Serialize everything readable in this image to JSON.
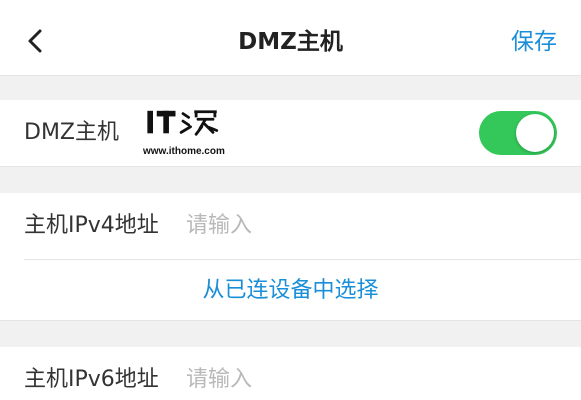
{
  "navbar": {
    "back_icon": "chevron-left-icon",
    "title": "DMZ主机",
    "save_label": "保存"
  },
  "dmz_section": {
    "label": "DMZ主机",
    "toggle_on": true,
    "toggle_color": "#34c759"
  },
  "watermark": {
    "logo_text": "IT之家",
    "url": "www.ithome.com"
  },
  "ipv4_section": {
    "label": "主机IPv4地址",
    "placeholder": "请输入",
    "select_link": "从已连设备中选择"
  },
  "ipv6_section": {
    "label": "主机IPv6地址",
    "placeholder": "请输入"
  },
  "colors": {
    "accent": "#1a8fd8",
    "background_gap": "#f1f1f1"
  }
}
